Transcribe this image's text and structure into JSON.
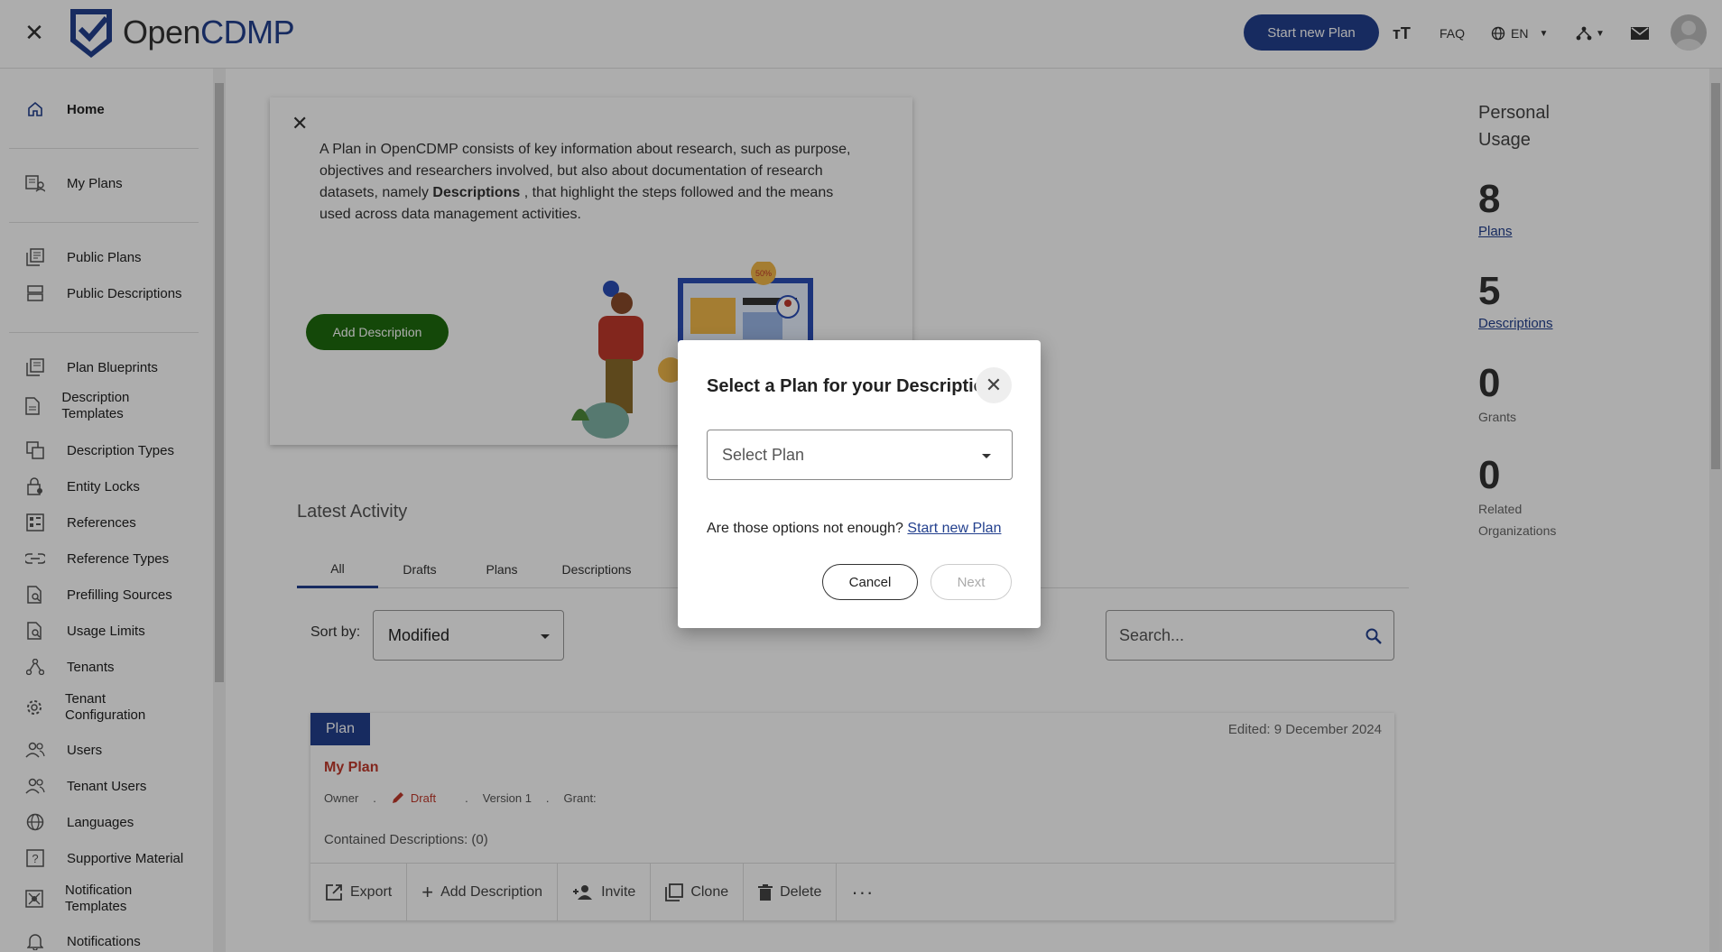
{
  "topbar": {
    "logo_open": "Open",
    "logo_cdmp": "CDMP",
    "start_plan": "Start new Plan",
    "faq": "FAQ",
    "language": "EN"
  },
  "sidebar": {
    "items": [
      {
        "label": "Home",
        "icon": "home-icon"
      },
      {
        "label": "My Plans",
        "icon": "my-plans-icon"
      },
      {
        "label": "Public Plans",
        "icon": "public-plans-icon"
      },
      {
        "label": "Public Descriptions",
        "icon": "public-descriptions-icon"
      },
      {
        "label": "Plan Blueprints",
        "icon": "blueprint-icon"
      },
      {
        "label": "Description Templates",
        "icon": "template-icon"
      },
      {
        "label": "Description Types",
        "icon": "types-icon"
      },
      {
        "label": "Entity Locks",
        "icon": "lock-icon"
      },
      {
        "label": "References",
        "icon": "references-icon"
      },
      {
        "label": "Reference Types",
        "icon": "reference-types-icon"
      },
      {
        "label": "Prefilling Sources",
        "icon": "prefilling-icon"
      },
      {
        "label": "Usage Limits",
        "icon": "usage-limits-icon"
      },
      {
        "label": "Tenants",
        "icon": "tenants-icon"
      },
      {
        "label": "Tenant Configuration",
        "icon": "gear-icon"
      },
      {
        "label": "Users",
        "icon": "users-icon"
      },
      {
        "label": "Tenant Users",
        "icon": "tenant-users-icon"
      },
      {
        "label": "Languages",
        "icon": "globe-icon"
      },
      {
        "label": "Supportive Material",
        "icon": "help-icon"
      },
      {
        "label": "Notification Templates",
        "icon": "notification-template-icon"
      },
      {
        "label": "Notifications",
        "icon": "bell-icon"
      }
    ]
  },
  "info": {
    "text_before": "A Plan in OpenCDMP consists of key information about research, such as purpose, objectives and researchers involved, but also about documentation of research datasets, namely ",
    "text_bold": "Descriptions",
    "text_after": " , that highlight the steps followed and the means used across data management activities.",
    "add_description": "Add Description"
  },
  "activity": {
    "title": "Latest Activity",
    "tabs": [
      "All",
      "Drafts",
      "Plans",
      "Descriptions"
    ],
    "sort_label": "Sort by:",
    "sort_value": "Modified",
    "search_placeholder": "Search..."
  },
  "plan_card": {
    "badge": "Plan",
    "edited": "Edited: 9 December 2024",
    "title": "My Plan",
    "owner": "Owner",
    "draft": "Draft",
    "version": "Version 1",
    "grant": "Grant:",
    "dot": ".",
    "contained": "Contained Descriptions: (0)",
    "actions": [
      "Export",
      "Add Description",
      "Invite",
      "Clone",
      "Delete"
    ]
  },
  "usage": {
    "title": "Personal Usage",
    "plans_count": "8",
    "plans_label": "Plans",
    "descriptions_count": "5",
    "descriptions_label": "Descriptions",
    "grants_count": "0",
    "grants_label": "Grants",
    "orgs_count": "0",
    "orgs_label": "Related Organizations"
  },
  "dialog": {
    "title": "Select a Plan for your Description",
    "select_placeholder": "Select Plan",
    "hint": "Are those options not enough?",
    "hint_link": "Start new Plan",
    "cancel": "Cancel",
    "next": "Next"
  },
  "colors": {
    "primary": "#23408e",
    "green": "#1e6b0e",
    "accent_red": "#c0392b"
  }
}
